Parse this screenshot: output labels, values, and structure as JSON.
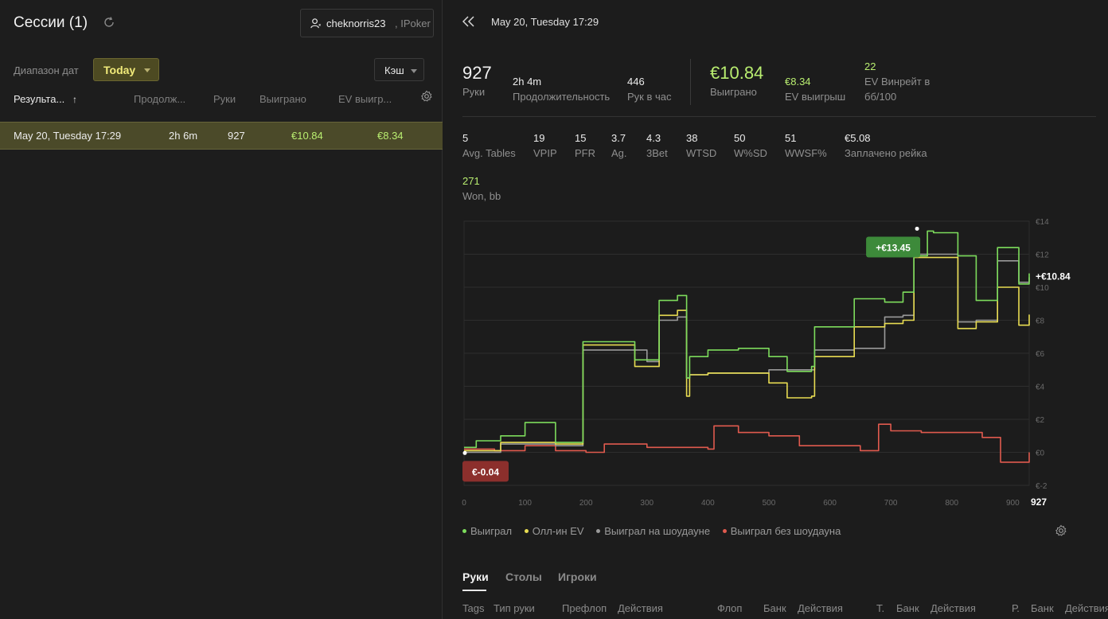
{
  "left": {
    "title": "Сессии (1)",
    "user": {
      "name": "cheknorris23",
      "room": ", IPoker"
    },
    "date_range_label": "Диапазон дат",
    "date_range_value": "Today",
    "game_type": "Кэш",
    "columns": [
      "Результа...",
      "Продолж...",
      "Руки",
      "Выиграно",
      "EV выигр..."
    ],
    "sort_icon": "↑",
    "rows": [
      {
        "date": "May 20, Tuesday 17:29",
        "duration": "2h 6m",
        "hands": "927",
        "won": "€10.84",
        "ev_won": "€8.34"
      }
    ]
  },
  "session": {
    "title": "May 20, Tuesday 17:29",
    "hands": {
      "value": "927",
      "label": "Руки"
    },
    "duration": {
      "value": "2h 4m",
      "label": "Продолжительность"
    },
    "hands_per_hour": {
      "value": "446",
      "label": "Рук в час"
    },
    "won": {
      "value": "€10.84",
      "label": "Выиграно"
    },
    "ev_won": {
      "value": "€8.34",
      "label": "EV выигрыш"
    },
    "ev_bb100": {
      "value": "22",
      "label1": "EV Винрейт в",
      "label2": "бб/100"
    }
  },
  "stats": [
    {
      "value": "5",
      "label": "Avg. Tables"
    },
    {
      "value": "19",
      "label": "VPIP"
    },
    {
      "value": "15",
      "label": "PFR"
    },
    {
      "value": "3.7",
      "label": "Ag."
    },
    {
      "value": "4.3",
      "label": "3Bet"
    },
    {
      "value": "38",
      "label": "WTSD"
    },
    {
      "value": "50",
      "label": "W%SD"
    },
    {
      "value": "51",
      "label": "WWSF%"
    },
    {
      "value": "€5.08",
      "label": "Заплачено рейка"
    }
  ],
  "won_bb": {
    "value": "271",
    "label": "Won, bb"
  },
  "chart_data": {
    "type": "line",
    "x_ticks": [
      0,
      100,
      200,
      300,
      400,
      500,
      600,
      700,
      800,
      900
    ],
    "x_end_label": "927",
    "y_ticks": [
      "€14",
      "€12",
      "€10",
      "€8",
      "€6",
      "€4",
      "€2",
      "€0",
      "€-2"
    ],
    "xlim": [
      0,
      927
    ],
    "ylim": [
      -2,
      14
    ],
    "grid": true,
    "annotations": {
      "max": "+€13.45",
      "min": "€-0.04",
      "final": "+€10.84"
    },
    "series": [
      {
        "name": "Выиграл",
        "color": "#7ddc5c",
        "x": [
          0,
          20,
          60,
          100,
          150,
          185,
          195,
          230,
          280,
          300,
          320,
          350,
          365,
          370,
          400,
          450,
          500,
          530,
          570,
          575,
          640,
          690,
          720,
          738,
          760,
          770,
          810,
          840,
          875,
          910,
          927
        ],
        "values": [
          0.3,
          0.7,
          1.0,
          1.8,
          0.6,
          0.6,
          6.7,
          6.7,
          5.6,
          5.6,
          9.2,
          9.5,
          4.5,
          5.8,
          6.2,
          6.3,
          5.8,
          4.9,
          5.2,
          7.6,
          9.3,
          9.1,
          9.7,
          11.9,
          13.4,
          13.3,
          11.9,
          9.2,
          12.4,
          10.2,
          10.84
        ]
      },
      {
        "name": "Олл-ин EV",
        "color": "#e8dc52",
        "x": [
          0,
          60,
          150,
          185,
          195,
          230,
          280,
          300,
          320,
          350,
          365,
          370,
          400,
          500,
          530,
          570,
          575,
          640,
          690,
          720,
          738,
          760,
          810,
          840,
          875,
          910,
          927
        ],
        "values": [
          0.1,
          0.6,
          0.5,
          0.5,
          6.5,
          6.5,
          5.2,
          5.2,
          8.3,
          8.6,
          3.4,
          4.7,
          4.8,
          4.2,
          3.3,
          3.4,
          5.8,
          7.6,
          7.8,
          8.0,
          11.8,
          11.8,
          7.5,
          7.9,
          10.0,
          7.7,
          8.34
        ]
      },
      {
        "name": "Выиграл на шоудауне",
        "color": "#9a9a9a",
        "x": [
          0,
          60,
          150,
          185,
          195,
          230,
          300,
          320,
          350,
          365,
          370,
          400,
          500,
          575,
          640,
          690,
          720,
          738,
          810,
          840,
          875,
          910,
          927
        ],
        "values": [
          0.0,
          0.5,
          0.4,
          0.4,
          6.2,
          6.2,
          5.5,
          8.0,
          8.2,
          4.5,
          4.7,
          4.8,
          5.0,
          6.2,
          6.3,
          8.2,
          8.3,
          12.0,
          7.9,
          8.0,
          11.6,
          10.3,
          10.6
        ]
      },
      {
        "name": "Выиграл без шоудауна",
        "color": "#e05a4e",
        "x": [
          0,
          50,
          100,
          150,
          200,
          230,
          300,
          350,
          400,
          410,
          450,
          500,
          550,
          600,
          650,
          680,
          700,
          750,
          800,
          850,
          870,
          880,
          927
        ],
        "values": [
          0.2,
          0.1,
          0.4,
          0.1,
          0.0,
          0.5,
          0.3,
          0.3,
          0.2,
          1.6,
          1.2,
          1.0,
          0.4,
          0.4,
          0.1,
          1.7,
          1.3,
          1.2,
          1.2,
          0.9,
          0.9,
          -0.6,
          0.0
        ]
      }
    ]
  },
  "chart_legend": [
    "Выиграл",
    "Олл-ин EV",
    "Выиграл на шоудауне",
    "Выиграл без шоудауна"
  ],
  "tabs": [
    "Руки",
    "Столы",
    "Игроки"
  ],
  "hand_columns": [
    "Tags",
    "Тип руки",
    "Префлоп",
    "Действия",
    "Флоп",
    "Банк",
    "Действия",
    "Т.",
    "Банк",
    "Действия",
    "Р.",
    "Банк",
    "Действия"
  ]
}
